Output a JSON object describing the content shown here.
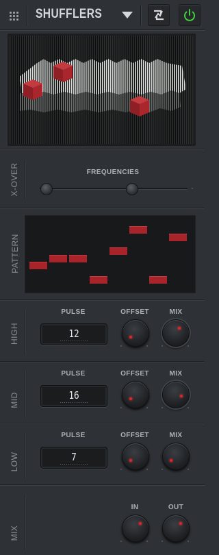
{
  "header": {
    "preset_name": "SHUFFLERS",
    "menu_icon": "grid-menu-icon",
    "dropdown_icon": "triangle-down-icon",
    "randomize_icon": "shuffle-icon",
    "power_icon": "power-icon",
    "power_color": "#3fcf3f"
  },
  "xover": {
    "label": "X-OVER",
    "title": "FREQUENCIES",
    "low_split": 0.02,
    "high_split": 0.62
  },
  "pattern": {
    "label": "PATTERN",
    "steps": [
      3,
      4,
      4,
      1,
      5,
      8,
      1,
      7
    ],
    "max": 9,
    "color": "#a8242a"
  },
  "bands": [
    {
      "label": "HIGH",
      "pulse_title": "PULSE",
      "pulse": "12",
      "offset_title": "OFFSET",
      "mix_title": "MIX"
    },
    {
      "label": "MID",
      "pulse_title": "PULSE",
      "pulse": "16",
      "offset_title": "OFFSET",
      "mix_title": "MIX"
    },
    {
      "label": "LOW",
      "pulse_title": "PULSE",
      "pulse": "7",
      "offset_title": "OFFSET",
      "mix_title": "MIX"
    }
  ],
  "mix": {
    "label": "MIX",
    "in_title": "IN",
    "out_title": "OUT"
  },
  "accent_color": "#e0242b"
}
